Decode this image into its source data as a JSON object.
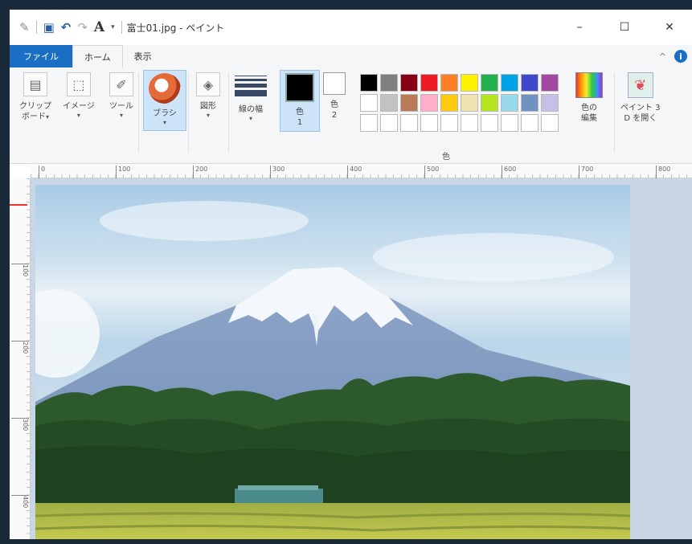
{
  "titlebar": {
    "title": "富士01.jpg - ペイント",
    "text_tool_glyph": "A",
    "controls": {
      "minimize": "–",
      "maximize": "☐",
      "close": "✕"
    }
  },
  "tabs": [
    {
      "label": "ファイル",
      "kind": "file"
    },
    {
      "label": "ホーム",
      "kind": "active"
    },
    {
      "label": "表示",
      "kind": "normal"
    }
  ],
  "ribbon": {
    "clipboard": {
      "label1": "クリップ",
      "label2": "ボード"
    },
    "image": {
      "label": "イメージ"
    },
    "tools": {
      "label": "ツール"
    },
    "brush": {
      "label": "ブラシ"
    },
    "shapes": {
      "label": "図形"
    },
    "size": {
      "label": "線の幅"
    },
    "color1": {
      "label1": "色",
      "label2": "1"
    },
    "color2": {
      "label1": "色",
      "label2": "2"
    },
    "colors_group_label": "色",
    "edit_colors": {
      "label1": "色の",
      "label2": "編集"
    },
    "paint3d": {
      "label1": "ペイント 3",
      "label2": "D を開く"
    },
    "palette": [
      "#000000",
      "#7f7f7f",
      "#880015",
      "#ed1c24",
      "#ff7f27",
      "#fff200",
      "#22b14c",
      "#00a2e8",
      "#3f48cc",
      "#a349a4",
      "#ffffff",
      "#c3c3c3",
      "#b97a57",
      "#ffaec9",
      "#ffc90e",
      "#efe4b0",
      "#b5e61d",
      "#99d9ea",
      "#7092be",
      "#c8bfe7",
      "#ffffff",
      "#ffffff",
      "#ffffff",
      "#ffffff",
      "#ffffff",
      "#ffffff",
      "#ffffff",
      "#ffffff",
      "#ffffff",
      "#ffffff"
    ]
  },
  "ruler": {
    "h_ticks": [
      "0",
      "100",
      "200",
      "300",
      "400",
      "500",
      "600",
      "700",
      "800"
    ],
    "v_ticks": [
      "100",
      "200",
      "300",
      "400"
    ]
  }
}
